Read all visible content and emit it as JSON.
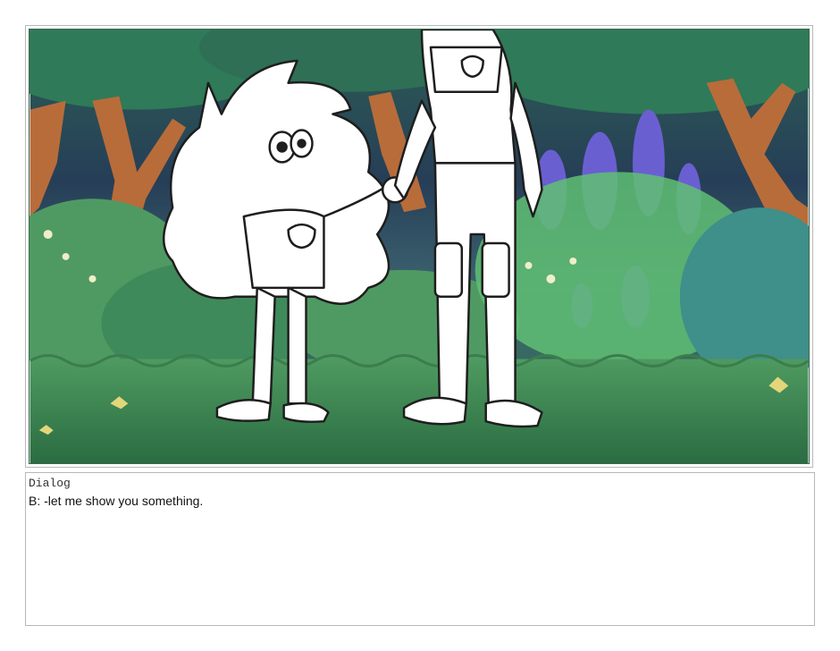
{
  "panel": {
    "art_description_icon": "storyboard-illustration",
    "colors": {
      "grass_dark": "#2f6b46",
      "grass_mid": "#4f9a63",
      "bush_light": "#6fcf7f",
      "lavender": "#6a5fd1",
      "trunk": "#b86c3a",
      "canopy": "#2f7a58",
      "sky_dark": "#253b52"
    }
  },
  "dialog": {
    "heading": "Dialog",
    "text": "B: -let me show you something."
  }
}
